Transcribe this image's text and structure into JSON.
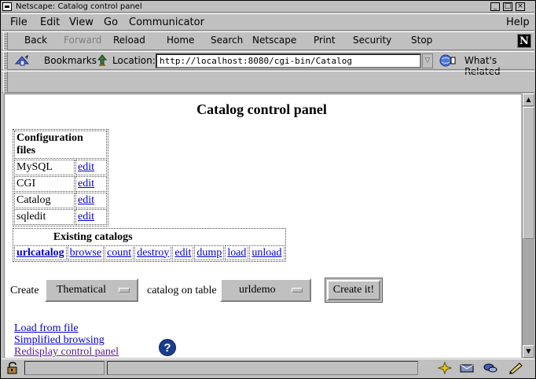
{
  "window": {
    "title": "Netscape: Catalog control panel",
    "buttons": [
      "_",
      "□",
      "×"
    ]
  },
  "menubar": {
    "items": [
      "File",
      "Edit",
      "View",
      "Go",
      "Communicator"
    ],
    "help": "Help"
  },
  "toolbar": {
    "back": "Back",
    "forward": "Forward",
    "reload": "Reload",
    "home": "Home",
    "search": "Search",
    "netscape": "Netscape",
    "print": "Print",
    "security": "Security",
    "stop": "Stop",
    "logo": "N"
  },
  "location_bar": {
    "bookmarks_label": "Bookmarks",
    "location_label": "Location:",
    "url": "http://localhost:8080/cgi-bin/Catalog",
    "whats_related": "What's Related"
  },
  "page": {
    "title": "Catalog control panel",
    "config_files": {
      "header": "Configuration files",
      "rows": [
        {
          "name": "MySQL",
          "action": "edit"
        },
        {
          "name": "CGI",
          "action": "edit"
        },
        {
          "name": "Catalog",
          "action": "edit"
        },
        {
          "name": "sqledit",
          "action": "edit"
        }
      ]
    },
    "existing_catalogs": {
      "header": "Existing catalogs",
      "catalog": "urlcatalog",
      "actions": [
        "browse",
        "count",
        "destroy",
        "edit",
        "dump",
        "load",
        "unload"
      ]
    },
    "create_form": {
      "create_label": "Create",
      "catalog_type": "Thematical",
      "on_table_label": "catalog on table",
      "table": "urldemo",
      "submit": "Create it!"
    },
    "links": {
      "load_from_file": "Load from file",
      "simplified_browsing": "Simplified browsing",
      "redisplay": "Redisplay control panel"
    },
    "help_icon": "?"
  },
  "status": {
    "text": ""
  },
  "colors": {
    "chrome": "#c0c0c0",
    "link": "#0000cc",
    "visited_link": "#551a8b",
    "help_icon": "#1a3e8c"
  },
  "icons": {
    "bookmarks": "bookmarks-icon",
    "location": "location-icon",
    "whats_related": "whats-related-icon",
    "lock": "lock-icon",
    "help": "help-icon"
  }
}
